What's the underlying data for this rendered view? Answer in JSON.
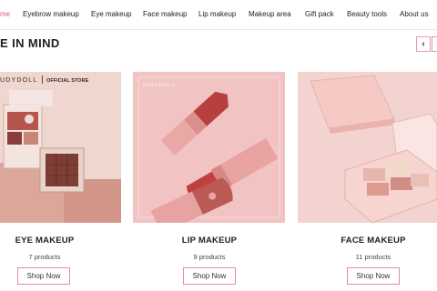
{
  "nav": {
    "items": [
      {
        "label": "me",
        "active": true
      },
      {
        "label": "Eyebrow makeup"
      },
      {
        "label": "Eye makeup"
      },
      {
        "label": "Face makeup"
      },
      {
        "label": "Lip makeup"
      },
      {
        "label": "Makeup area"
      },
      {
        "label": "Gift pack"
      },
      {
        "label": "Beauty tools"
      },
      {
        "label": "About us"
      }
    ]
  },
  "section": {
    "title": "E IN MIND",
    "prev_icon": "chevron-left-icon",
    "prev_glyph": "‹"
  },
  "cards": [
    {
      "title": "EYE MAKEUP",
      "count": "7 products",
      "button": "Shop Now",
      "image_brand": "UDYDOLL",
      "image_badge": "OFFICIAL STORE"
    },
    {
      "title": "LIP MAKEUP",
      "count": "9 products",
      "button": "Shop Now",
      "image_brand": "JUDYDOLL"
    },
    {
      "title": "FACE MAKEUP",
      "count": "11 products",
      "button": "Shop Now"
    }
  ],
  "colors": {
    "accent": "#e0566b",
    "button_border": "#e58b9a",
    "card_bg": "#f2c9c6"
  }
}
